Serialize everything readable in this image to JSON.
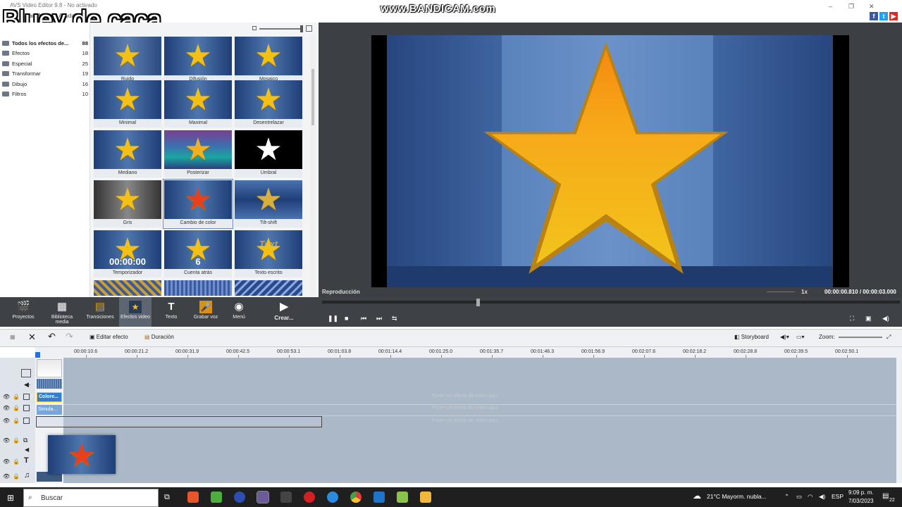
{
  "window": {
    "title": "AVS Video Editor 9.8 - No activado",
    "subtitle": "...dar Montage Ayuda"
  },
  "overlay_text": "Bluey de caca",
  "watermark": "www.BANDICAM.com",
  "window_controls": {
    "minimize": "–",
    "maximize": "❐",
    "close": "✕"
  },
  "social": [
    "f",
    "t",
    "▶"
  ],
  "sidebar": {
    "items": [
      {
        "label": "Todos los efectos de...",
        "count": "88"
      },
      {
        "label": "Efectos",
        "count": "18"
      },
      {
        "label": "Especial",
        "count": "25"
      },
      {
        "label": "Transformar",
        "count": "19"
      },
      {
        "label": "Dibujo",
        "count": "16"
      },
      {
        "label": "Filtros",
        "count": "10"
      }
    ]
  },
  "effects": {
    "tiles": [
      {
        "label": "Ruido"
      },
      {
        "label": "Difusión"
      },
      {
        "label": "Mosaico"
      },
      {
        "label": "Minimal"
      },
      {
        "label": "Maximal"
      },
      {
        "label": "Desentrelazar"
      },
      {
        "label": "Mediano"
      },
      {
        "label": "Posterizar"
      },
      {
        "label": "Umbral"
      },
      {
        "label": "Gris"
      },
      {
        "label": "Cambio de color"
      },
      {
        "label": "Tilt-shift"
      },
      {
        "label": "Temporizador",
        "overlay": "00:00:00"
      },
      {
        "label": "Cuenta atrás",
        "overlay": "6"
      },
      {
        "label": "Texto escrito",
        "overlay": "Text"
      }
    ]
  },
  "preview": {
    "label": "Reproducción",
    "speed": "1x",
    "time": "00:00:00.810 / 00:00:03.000"
  },
  "toolbar": {
    "items": [
      {
        "label": "Proyectos",
        "icon": "clapper-icon"
      },
      {
        "label": "Biblioteca media",
        "icon": "film-icon"
      },
      {
        "label": "Transiciones",
        "icon": "transition-icon"
      },
      {
        "label": "Efectos video",
        "icon": "star-icon"
      },
      {
        "label": "Texto",
        "icon": "text-icon"
      },
      {
        "label": "Grabar voz",
        "icon": "mic-icon"
      },
      {
        "label": "Menú",
        "icon": "disc-icon"
      },
      {
        "label": "Crear...",
        "icon": "create-icon"
      }
    ]
  },
  "timeline": {
    "edit_effect": "Editar efecto",
    "duration": "Duración",
    "storyboard": "Storyboard",
    "zoom_label": "Zoom:",
    "ruler": [
      "00:00:10.6",
      "00:00:21.2",
      "00:00:31.9",
      "00:00:42.5",
      "00:00:53.1",
      "00:01:03.8",
      "00:01:14.4",
      "00:01:25.0",
      "00:01:35.7",
      "00:01:46.3",
      "00:01:56.9",
      "00:02:07.6",
      "00:02:18.2",
      "00:02:28.8",
      "00:02:39.5",
      "00:02:50.1"
    ],
    "clips": {
      "effect1": "Colore...",
      "effect2": "Simula..."
    },
    "hint": "Poner un efecto de vídeo aquí"
  },
  "taskbar": {
    "search_placeholder": "Buscar",
    "weather": "21°C  Mayorm. nubla...",
    "lang": "ESP",
    "time": "9:09 p. m.",
    "date": "7/03/2023",
    "notif": "22"
  }
}
